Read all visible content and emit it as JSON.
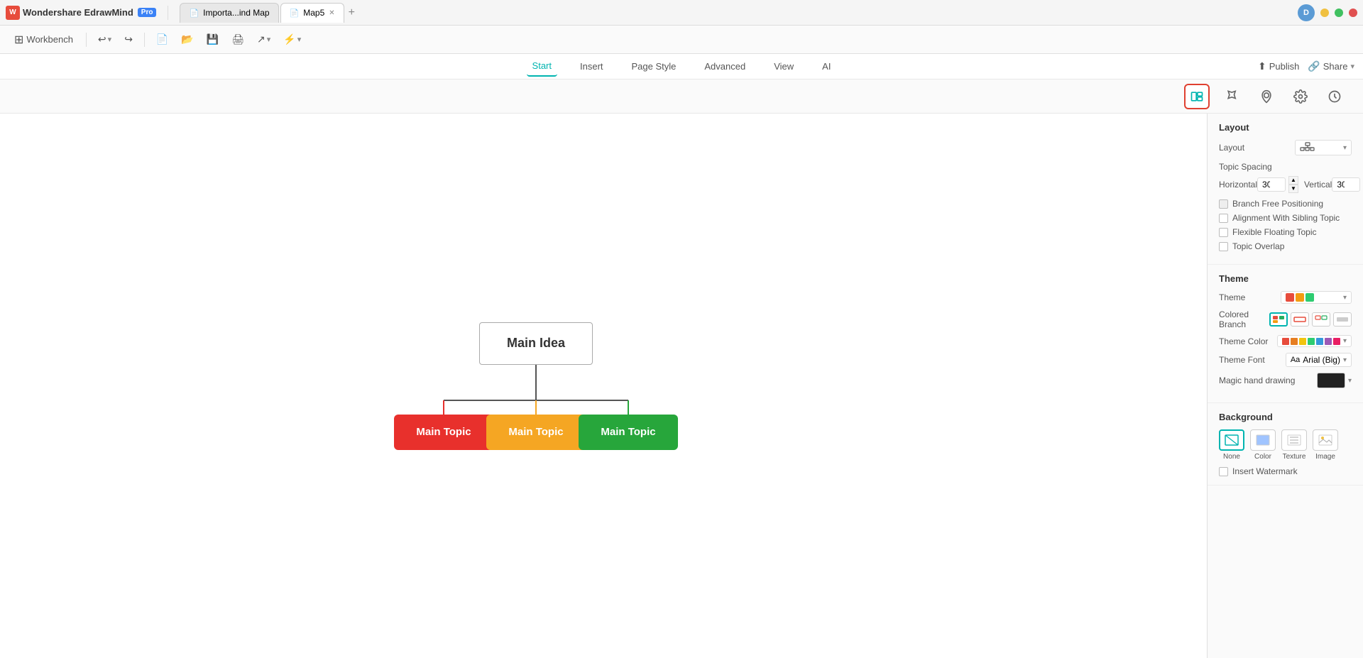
{
  "titlebar": {
    "app_name": "Wondershare EdrawMind",
    "pro_label": "Pro",
    "tab1_label": "Importa...ind Map",
    "tab2_label": "Map5",
    "workbench_label": "Workbench",
    "user_initial": "D"
  },
  "menu": {
    "items": [
      "Start",
      "Insert",
      "Page Style",
      "Advanced",
      "View",
      "AI"
    ],
    "active": "Start",
    "publish_label": "Publish",
    "share_label": "Share"
  },
  "mindmap": {
    "main_idea_label": "Main Idea",
    "topic1_label": "Main Topic",
    "topic2_label": "Main Topic",
    "topic3_label": "Main Topic"
  },
  "panel": {
    "layout_section_title": "Layout",
    "layout_label": "Layout",
    "topic_spacing_label": "Topic Spacing",
    "horizontal_label": "Horizontal",
    "horizontal_val": "30",
    "vertical_label": "Vertical",
    "vertical_val": "30",
    "branch_free_label": "Branch Free Positioning",
    "alignment_label": "Alignment With Sibling Topic",
    "flexible_label": "Flexible Floating Topic",
    "overlap_label": "Topic Overlap",
    "theme_section_title": "Theme",
    "theme_label": "Theme",
    "colored_branch_label": "Colored Branch",
    "theme_color_label": "Theme Color",
    "theme_font_label": "Theme Font",
    "theme_font_val": "Arial (Big)",
    "magic_hand_label": "Magic hand drawing",
    "background_section_title": "Background",
    "bg_none_label": "None",
    "bg_color_label": "Color",
    "bg_texture_label": "Texture",
    "bg_image_label": "Image",
    "watermark_label": "Insert Watermark"
  }
}
